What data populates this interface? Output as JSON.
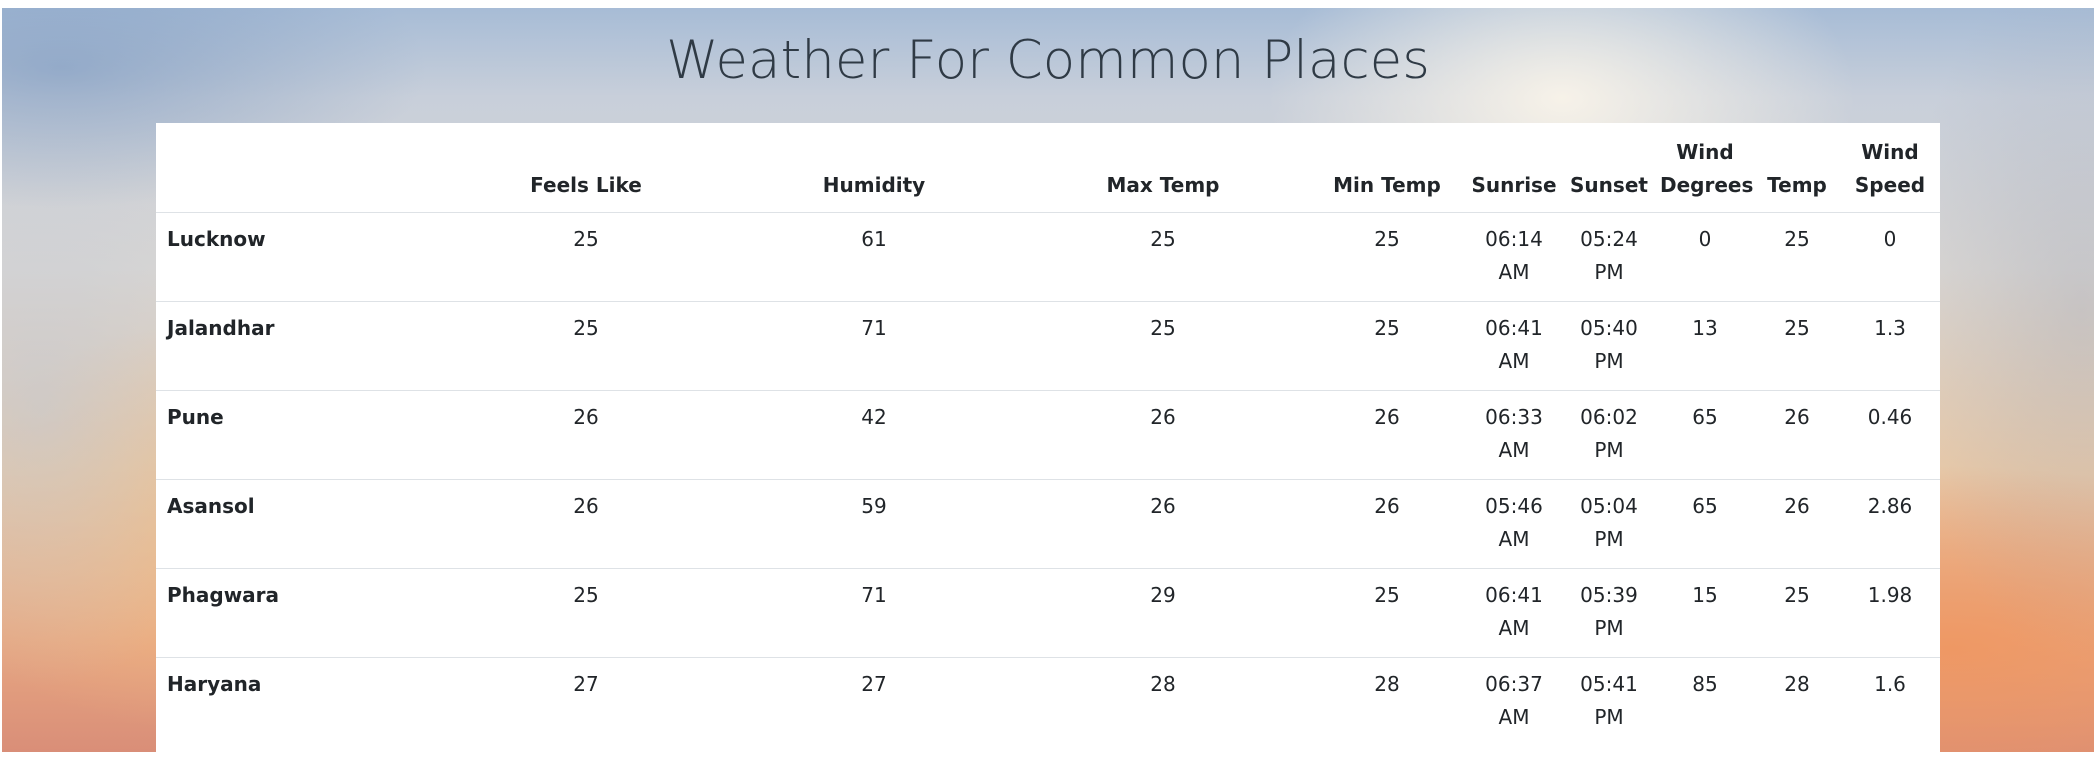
{
  "page": {
    "title": "Weather For Common Places"
  },
  "table": {
    "headers": {
      "place": "",
      "feels_like": "Feels Like",
      "humidity": "Humidity",
      "max_temp": "Max Temp",
      "min_temp": "Min Temp",
      "sunrise": "Sunrise",
      "sunset": "Sunset",
      "wind_degrees": "Wind Degrees",
      "temp": "Temp",
      "wind_speed": "Wind Speed"
    },
    "rows": [
      {
        "place": "Lucknow",
        "feels_like": "25",
        "humidity": "61",
        "max_temp": "25",
        "min_temp": "25",
        "sunrise": "06:14 AM",
        "sunset": "05:24 PM",
        "wind_degrees": "0",
        "temp": "25",
        "wind_speed": "0"
      },
      {
        "place": "Jalandhar",
        "feels_like": "25",
        "humidity": "71",
        "max_temp": "25",
        "min_temp": "25",
        "sunrise": "06:41 AM",
        "sunset": "05:40 PM",
        "wind_degrees": "13",
        "temp": "25",
        "wind_speed": "1.3"
      },
      {
        "place": "Pune",
        "feels_like": "26",
        "humidity": "42",
        "max_temp": "26",
        "min_temp": "26",
        "sunrise": "06:33 AM",
        "sunset": "06:02 PM",
        "wind_degrees": "65",
        "temp": "26",
        "wind_speed": "0.46"
      },
      {
        "place": "Asansol",
        "feels_like": "26",
        "humidity": "59",
        "max_temp": "26",
        "min_temp": "26",
        "sunrise": "05:46 AM",
        "sunset": "05:04 PM",
        "wind_degrees": "65",
        "temp": "26",
        "wind_speed": "2.86"
      },
      {
        "place": "Phagwara",
        "feels_like": "25",
        "humidity": "71",
        "max_temp": "29",
        "min_temp": "25",
        "sunrise": "06:41 AM",
        "sunset": "05:39 PM",
        "wind_degrees": "15",
        "temp": "25",
        "wind_speed": "1.98"
      },
      {
        "place": "Haryana",
        "feels_like": "27",
        "humidity": "27",
        "max_temp": "28",
        "min_temp": "28",
        "sunrise": "06:37 AM",
        "sunset": "05:41 PM",
        "wind_degrees": "85",
        "temp": "28",
        "wind_speed": "1.6"
      }
    ]
  }
}
